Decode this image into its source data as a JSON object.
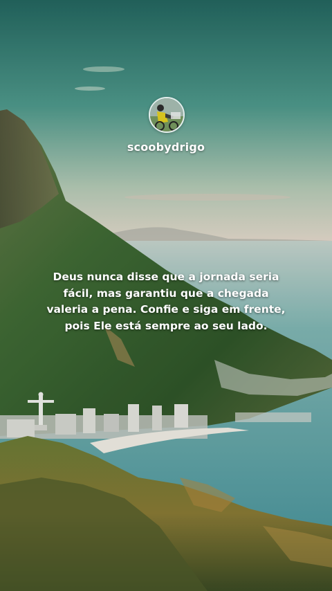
{
  "profile": {
    "username": "scoobydrigo",
    "avatar_icon": "cyclist-avatar-icon"
  },
  "post": {
    "quote": "Deus nunca disse que a jornada seria fácil, mas garantiu que a chegada valeria a pena. Confie e siga em frente, pois Ele está sempre ao seu lado."
  },
  "background": {
    "scene": "rio-de-janeiro-coastline-image",
    "colors": {
      "sky_top": "#2f7f72",
      "sky_bottom": "#f0ddd0",
      "sea": "#4d9ea6",
      "mountain": "#3e6b35"
    }
  }
}
